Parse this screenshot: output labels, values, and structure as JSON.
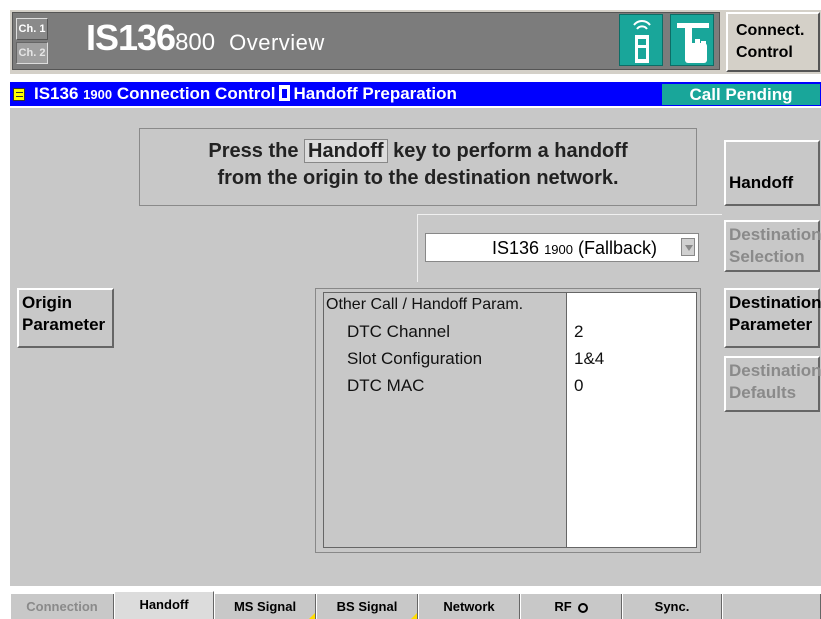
{
  "title": {
    "channel_1": "Ch. 1",
    "channel_2": "Ch. 2",
    "standard": "IS136",
    "band": "800",
    "view": "Overview",
    "connect_control": [
      "Connect.",
      "Control"
    ]
  },
  "status": {
    "standard": "IS136",
    "band": "1900",
    "section": "Connection Control",
    "page": "Handoff Preparation",
    "state": "Call Pending"
  },
  "main": {
    "hint": {
      "pre": "Press the",
      "key": "Handoff",
      "post_line1": "key to perform a handoff",
      "line2": "from the origin to the destination network."
    },
    "destination_network": {
      "standard": "IS136",
      "band": "1900",
      "mode": "(Fallback)"
    },
    "params_panel": {
      "heading": "Other Call / Handoff Param.",
      "rows": [
        {
          "label": "DTC Channel",
          "value": "2"
        },
        {
          "label": "Slot Configuration",
          "value": "1&4"
        },
        {
          "label": "DTC MAC",
          "value": "0"
        }
      ]
    }
  },
  "softkeys": {
    "handoff": "Handoff",
    "destination_selection": [
      "Destination",
      "Selection"
    ],
    "destination_parameter": [
      "Destination",
      "Parameter"
    ],
    "destination_defaults": [
      "Destination",
      "Defaults"
    ],
    "origin_parameter": [
      "Origin",
      "Parameter"
    ]
  },
  "tabs": [
    {
      "label": "Connection",
      "state": "disabled"
    },
    {
      "label": "Handoff",
      "state": "active"
    },
    {
      "label": "MS Signal",
      "state": "normal"
    },
    {
      "label": "BS Signal",
      "state": "normal"
    },
    {
      "label": "Network",
      "state": "normal"
    },
    {
      "label": "RF",
      "state": "normal"
    },
    {
      "label": "Sync.",
      "state": "normal"
    }
  ],
  "icons": {
    "title_phone": "mobile-signal-icon",
    "title_hand": "hand-pointer-icon",
    "status_menu": "menu-icon",
    "status_phone": "mobile-icon",
    "dropdown": "dropdown-arrow-icon",
    "rf": "rf-connector-icon"
  },
  "colors": {
    "status_bar": "#0000ff",
    "accent_teal": "#19a69a",
    "background": "#c8c8c8",
    "title_bar": "#7c7c7c"
  }
}
